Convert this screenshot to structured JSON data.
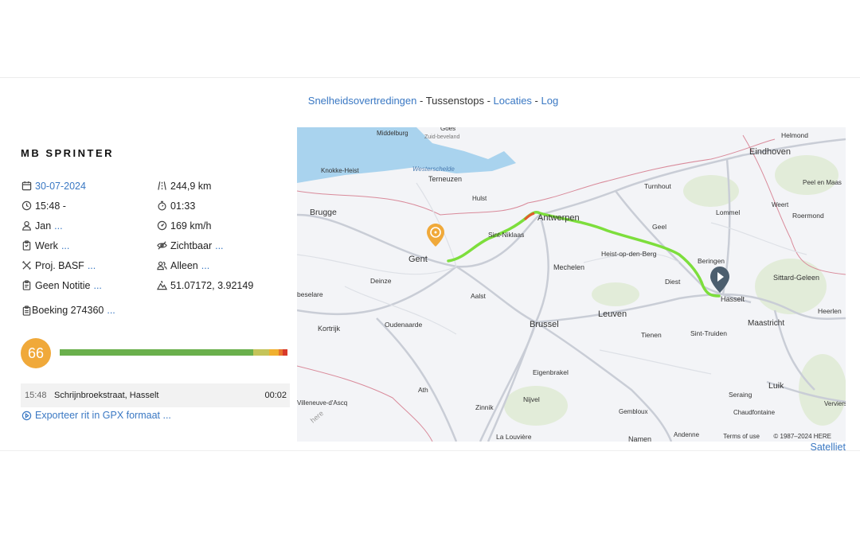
{
  "nav": {
    "speed_violations": "Snelheidsovertredingen",
    "sep1": " - ",
    "stops": "Tussenstops",
    "sep2": " - ",
    "locations": "Locaties",
    "sep3": " - ",
    "log": "Log"
  },
  "vehicle": {
    "name": "MB SPRINTER"
  },
  "info": {
    "date": "30-07-2024",
    "distance": "244,9 km",
    "time": "15:48 -",
    "duration": "01:33",
    "driver": "Jan",
    "max_speed": "169 km/h",
    "type": "Werk",
    "visibility": "Zichtbaar",
    "project": "Proj. BASF",
    "company": "Alleen",
    "note": "Geen Notitie",
    "coordinates": "51.07172, 3.92149",
    "more": "..."
  },
  "booking": {
    "label": "Boeking 274360",
    "more": "..."
  },
  "score": {
    "value": "66",
    "bar_segments": [
      {
        "fraction": 0.85,
        "color": "#6ab04c"
      },
      {
        "fraction": 0.07,
        "color": "#c4c45a"
      },
      {
        "fraction": 0.04,
        "color": "#f0b030"
      },
      {
        "fraction": 0.02,
        "color": "#e8742c"
      },
      {
        "fraction": 0.02,
        "color": "#d83a2a"
      }
    ]
  },
  "stop": {
    "time": "15:48",
    "address": "Schrijnbroekstraat, Hasselt",
    "duration": "00:02"
  },
  "export": {
    "label": "Exporteer rit in GPX formaat ..."
  },
  "map": {
    "terms": "Terms of use",
    "copyright": "© 1987–2024 HERE",
    "satellite": "Satelliet",
    "places": [
      "Middelburg",
      "Goes",
      "Zuid-beveland",
      "Knokke-Heist",
      "Westerschelde",
      "Terneuzen",
      "Hulst",
      "Brugge",
      "Antwerpen",
      "Sint-Niklaas",
      "Gent",
      "Deinze",
      "Mechelen",
      "Aalst",
      "Eindhoven",
      "Helmond",
      "Turnhout",
      "Weert",
      "Peel en Maas",
      "Roermond",
      "Lommel",
      "Geel",
      "Heist-op-den-Berg",
      "Beringen",
      "Diest",
      "Sittard-Geleen",
      "Hasselt",
      "Leuven",
      "Brussel",
      "Heerlen",
      "Maastricht",
      "Kortrijk",
      "Oudenaarde",
      "Tienen",
      "Sint-Truiden",
      "Eigenbrakel",
      "Nijvel",
      "Ath",
      "Luik",
      "Seraing",
      "Chaudfontaine",
      "Gembloux",
      "Zinnik",
      "Villeneuve-d'Ascq",
      "La Louvière",
      "Andenne",
      "Namen",
      "Verviers",
      "beselare",
      "here"
    ]
  }
}
